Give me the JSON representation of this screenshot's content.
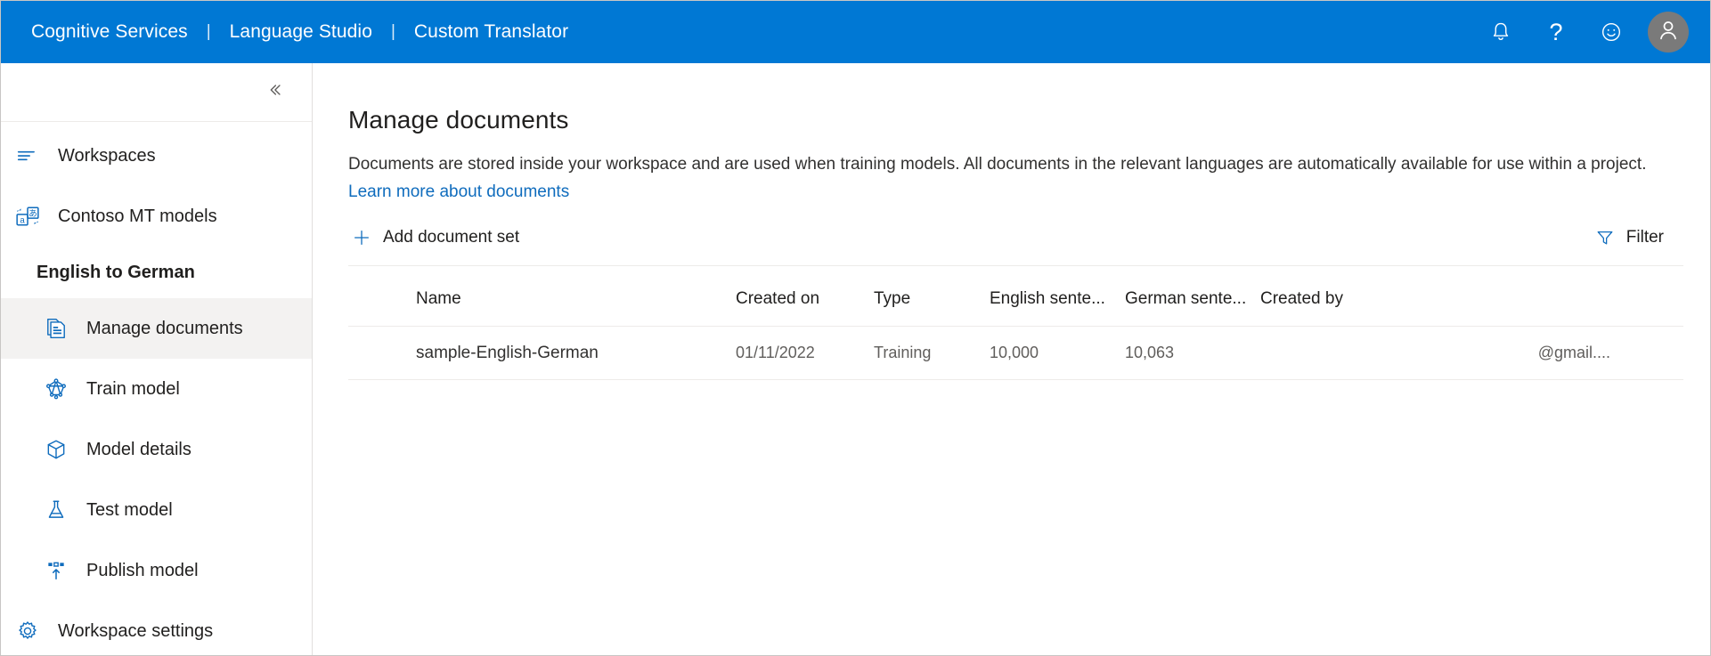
{
  "header": {
    "brand_items": [
      {
        "label": "Cognitive Services",
        "name": "cognitive-services"
      },
      {
        "label": "Language Studio",
        "name": "language-studio"
      },
      {
        "label": "Custom Translator",
        "name": "custom-translator"
      }
    ],
    "separator": "|",
    "actions": [
      {
        "icon": "bell-icon",
        "label": "Notifications"
      },
      {
        "icon": "question-mark-icon",
        "label": "Help"
      },
      {
        "icon": "smiley-icon",
        "label": "Feedback"
      },
      {
        "icon": "account-avatar-icon",
        "label": "Account"
      }
    ],
    "help_glyph": "?",
    "background_color": "#0078d4"
  },
  "sidebar": {
    "collapse_icon": "double-chevron-left-icon",
    "items": [
      {
        "label": "Workspaces",
        "icon": "workspaces-icon",
        "indent": false,
        "selected": false
      },
      {
        "label": "Contoso MT models",
        "icon": "translation-models-icon",
        "indent": false,
        "selected": false
      }
    ],
    "section_label": "English to German",
    "project_items": [
      {
        "label": "Manage documents",
        "icon": "documents-icon",
        "selected": true
      },
      {
        "label": "Train model",
        "icon": "train-model-icon",
        "selected": false
      },
      {
        "label": "Model details",
        "icon": "package-icon",
        "selected": false
      },
      {
        "label": "Test model",
        "icon": "flask-icon",
        "selected": false
      },
      {
        "label": "Publish model",
        "icon": "publish-icon",
        "selected": false
      }
    ],
    "settings_item": {
      "label": "Workspace settings",
      "icon": "gear-icon"
    },
    "selected_bg": "#f3f2f1",
    "icon_color": "#0f6cbd"
  },
  "main": {
    "title": "Manage documents",
    "description_part1": "Documents are stored inside your workspace and are used when training models. All documents in the relevant languages are automatically available for use within a project. ",
    "description_link": "Learn more about documents",
    "toolbar": {
      "add_label": "Add document set",
      "add_icon": "plus-icon",
      "filter_label": "Filter",
      "filter_icon": "funnel-icon"
    },
    "table": {
      "columns": [
        "Name",
        "Created on",
        "Type",
        "English sente...",
        "German sente...",
        "Created by"
      ],
      "rows": [
        {
          "name": "sample-English-German",
          "created_on": "01/11/2022",
          "type": "Training",
          "english_sentences": "10,000",
          "german_sentences": "10,063",
          "created_by": "@gmail...."
        }
      ]
    }
  }
}
